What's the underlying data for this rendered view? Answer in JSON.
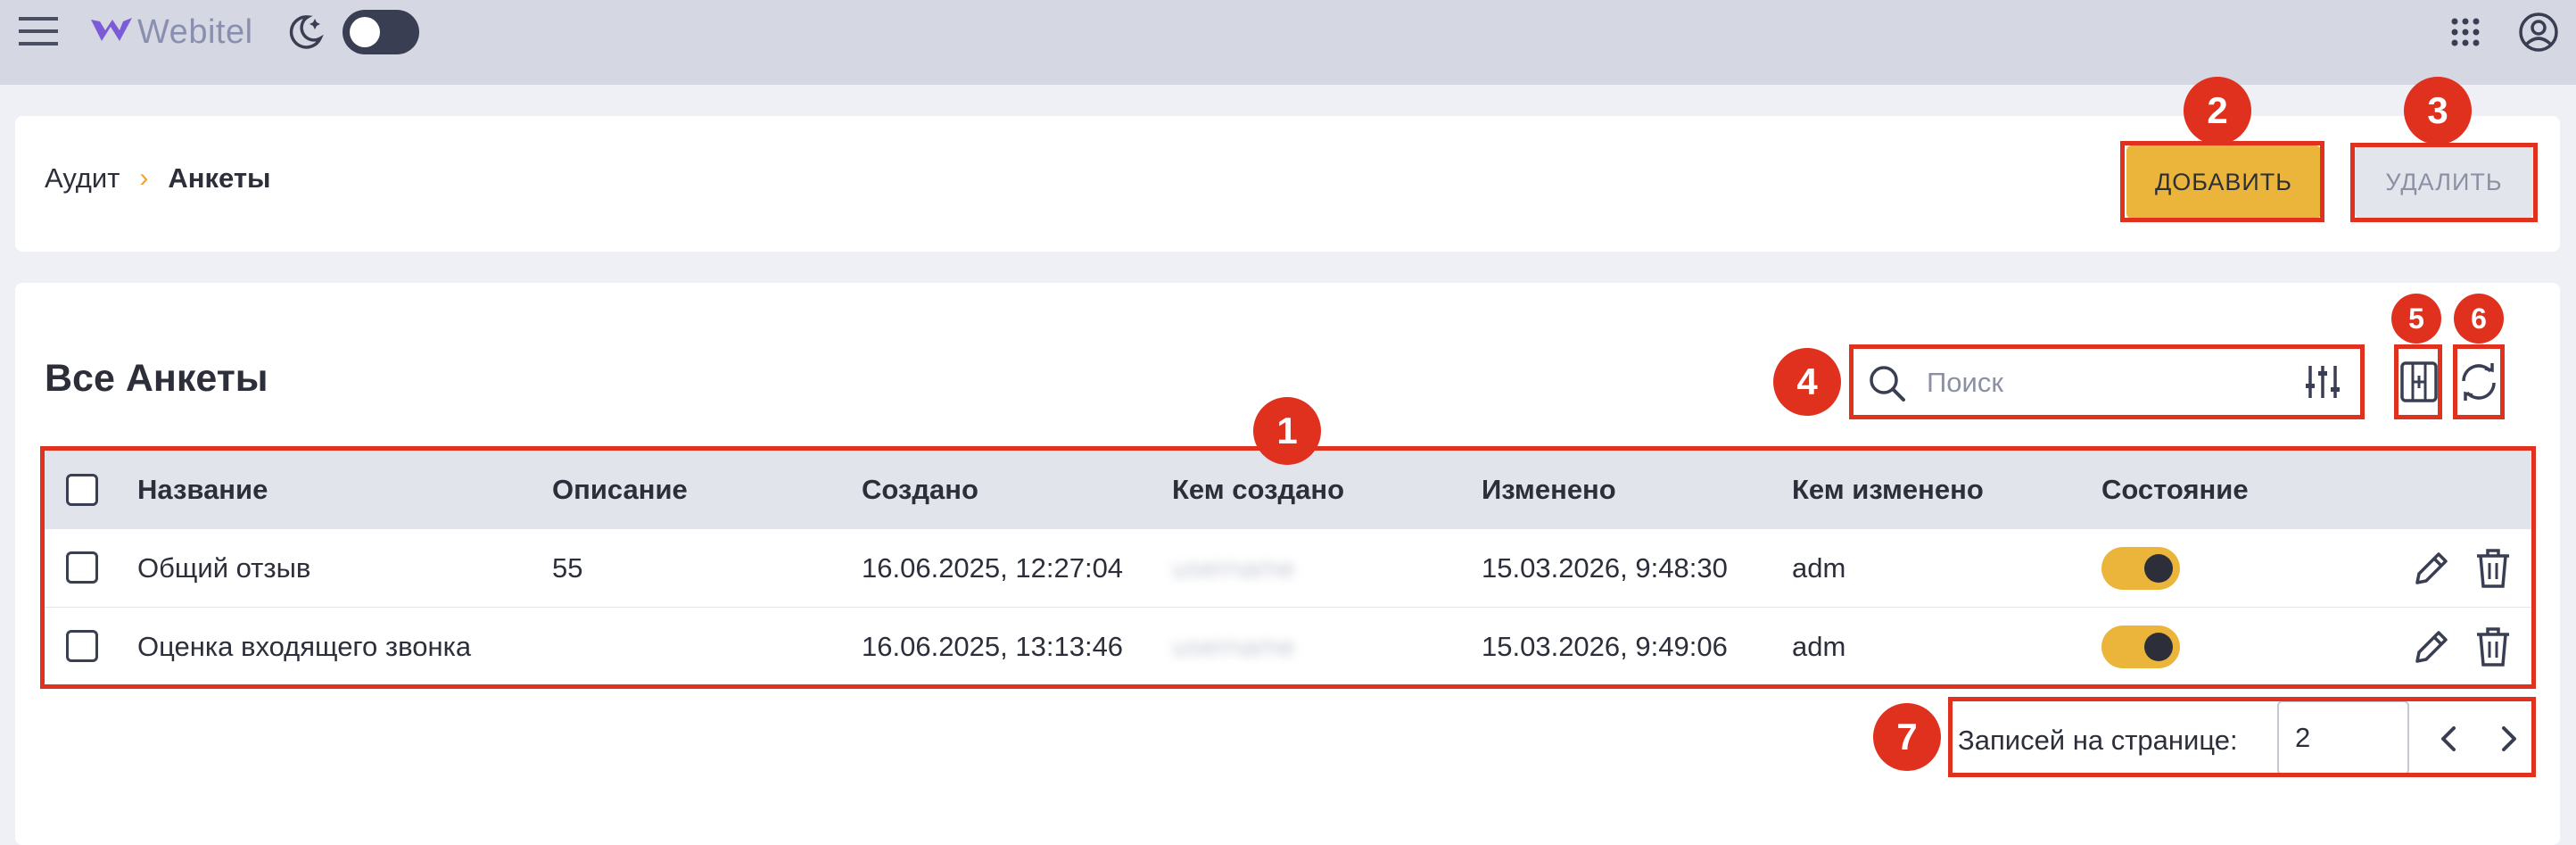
{
  "app": {
    "name": "Webitel"
  },
  "breadcrumb": {
    "parent": "Аудит",
    "current": "Анкеты"
  },
  "actions": {
    "add_label": "ДОБАВИТЬ",
    "delete_label": "УДАЛИТЬ"
  },
  "section": {
    "title": "Все Анкеты"
  },
  "search": {
    "placeholder": "Поиск"
  },
  "table": {
    "columns": [
      "Название",
      "Описание",
      "Создано",
      "Кем создано",
      "Изменено",
      "Кем изменено",
      "Состояние"
    ],
    "rows": [
      {
        "name": "Общий отзыв",
        "description": "55",
        "created": "16.06.2025, 12:27:04",
        "created_by": "username",
        "modified": "15.03.2026, 9:48:30",
        "modified_by": "adm",
        "state": true
      },
      {
        "name": "Оценка входящего звонка",
        "description": "",
        "created": "16.06.2025, 13:13:46",
        "created_by": "username",
        "modified": "15.03.2026, 9:49:06",
        "modified_by": "adm",
        "state": true
      }
    ]
  },
  "pagination": {
    "label": "Записей на странице:",
    "per_page": "2"
  },
  "markers": [
    "1",
    "2",
    "3",
    "4",
    "5",
    "6",
    "7"
  ],
  "icons": [
    "menu-icon",
    "webitel-logo-icon",
    "moon-stars-icon",
    "apps-grid-icon",
    "user-circle-icon",
    "search-icon",
    "filter-sliders-icon",
    "column-select-icon",
    "refresh-icon",
    "edit-icon",
    "trash-icon",
    "chevron-left-icon",
    "chevron-right-icon"
  ],
  "colors": {
    "accent": "#eab53a",
    "marker": "#e0301e",
    "topbar": "#d5d8e3",
    "header_row": "#e2e4ec"
  }
}
